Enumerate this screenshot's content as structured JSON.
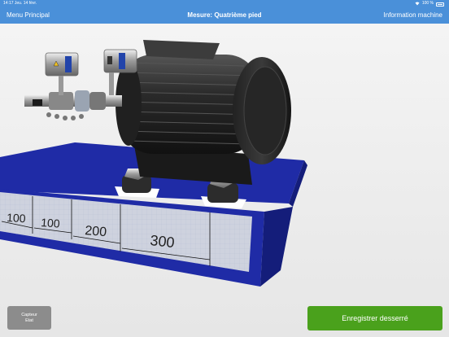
{
  "status_bar": {
    "time_date": "14:17  Jeu. 14 févr.",
    "battery": "100 %"
  },
  "nav": {
    "back_label": "Menu Principal",
    "title": "Mesure: Quatrième pied",
    "info_label": "Information machine"
  },
  "scene": {
    "dimension_labels": [
      "100",
      "100",
      "200",
      "300"
    ]
  },
  "buttons": {
    "sensor_line1": "Capteur",
    "sensor_line2": "Etat",
    "save_label": "Enregistrer desserré"
  },
  "colors": {
    "nav_bg": "#4a90d9",
    "base_blue": "#1f2ba6",
    "save_green": "#4aa11c",
    "sensor_grey": "#8c8c8c"
  }
}
